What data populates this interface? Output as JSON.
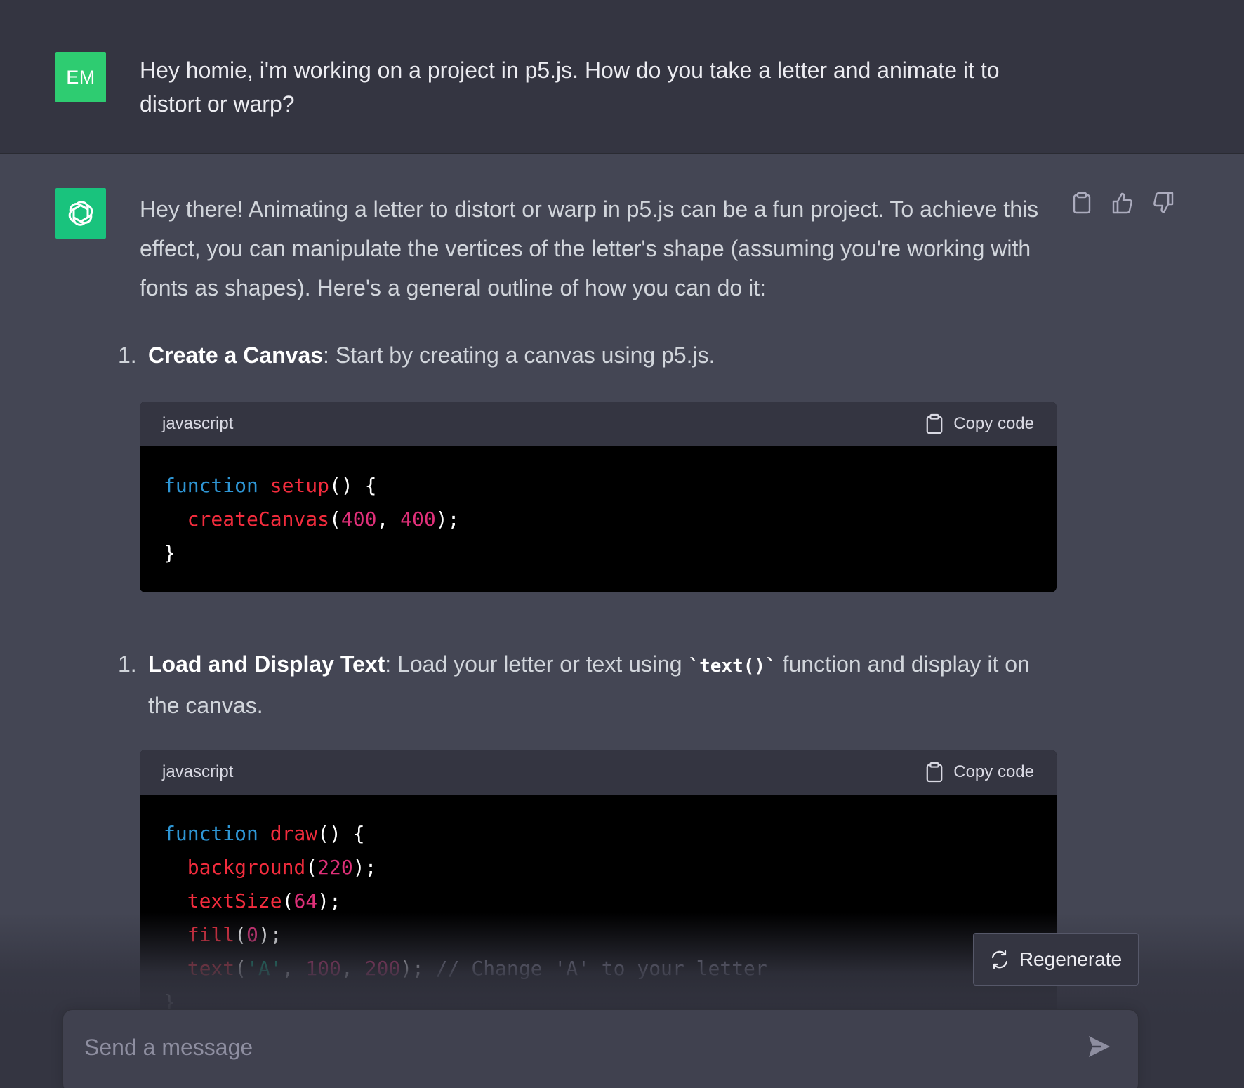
{
  "user_message": {
    "avatar_initials": "EM",
    "text": "Hey homie, i'm working on a project in p5.js. How do you take a letter and animate it to distort or warp?"
  },
  "assistant_message": {
    "intro": "Hey there! Animating a letter to distort or warp in p5.js can be a fun project. To achieve this effect, you can manipulate the vertices of the letter's shape (assuming you're working with fonts as shapes). Here's a general outline of how you can do it:",
    "steps": [
      {
        "number": "1.",
        "title": "Create a Canvas",
        "text": ": Start by creating a canvas using p5.js."
      },
      {
        "number": "1.",
        "title": "Load and Display Text",
        "text_before": ": Load your letter or text using ",
        "inline_code": "`text()`",
        "text_after": " function and display it on the canvas."
      }
    ],
    "code_blocks": [
      {
        "language": "javascript",
        "copy_label": "Copy code"
      },
      {
        "language": "javascript",
        "copy_label": "Copy code"
      }
    ]
  },
  "controls": {
    "regenerate_label": "Regenerate",
    "message_placeholder": "Send a message"
  },
  "icons": {
    "copy": "clipboard-icon",
    "like": "thumbs-up-icon",
    "dislike": "thumbs-down-icon",
    "regenerate": "refresh-icon",
    "send": "paper-plane-icon",
    "assistant": "openai-logo-icon"
  },
  "colors": {
    "user_avatar": "#2ecc71",
    "assistant_avatar": "#19c37d",
    "keyword": "#2e95d3",
    "function": "#f22c3d",
    "number": "#df3079",
    "string": "#00a67d",
    "comment": "#8e8ea0"
  }
}
